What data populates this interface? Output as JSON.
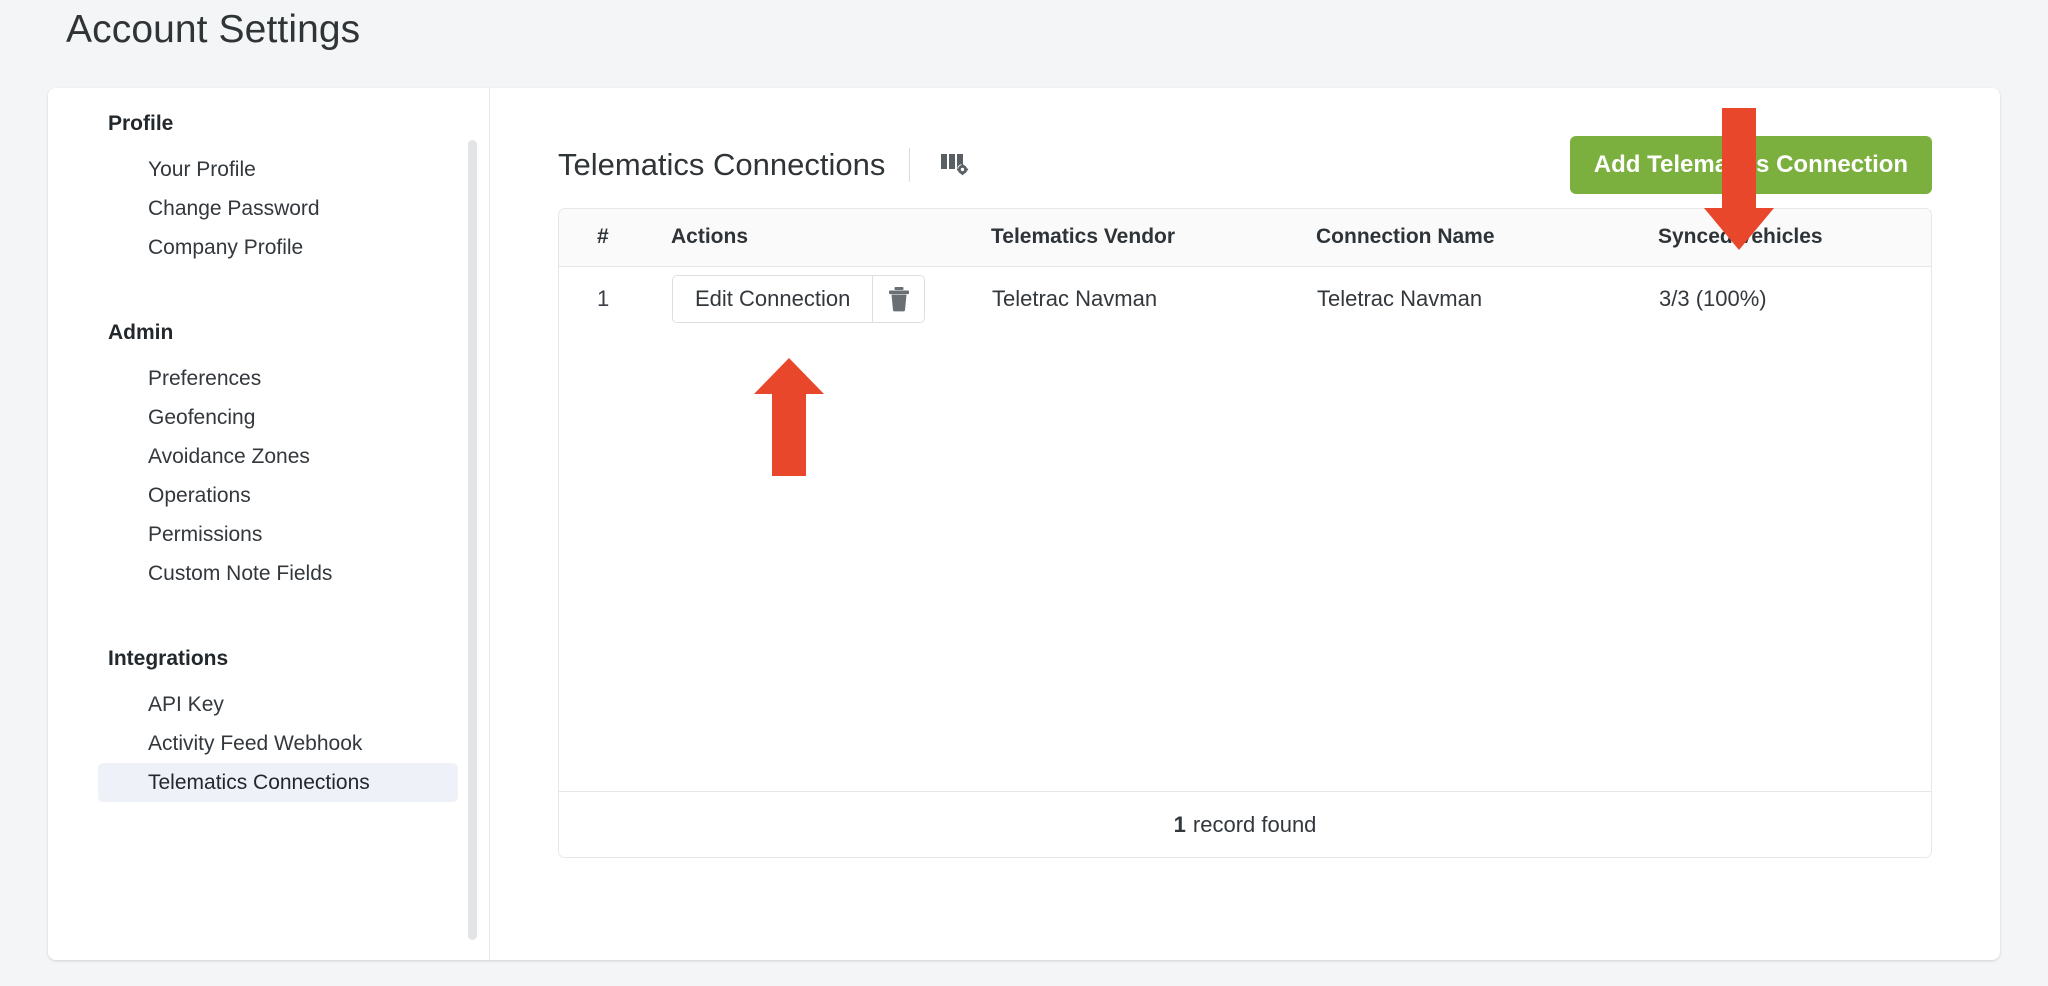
{
  "page": {
    "title": "Account Settings"
  },
  "sidebar": {
    "groups": [
      {
        "title": "Profile",
        "items": [
          {
            "label": "Your Profile",
            "active": false
          },
          {
            "label": "Change Password",
            "active": false
          },
          {
            "label": "Company Profile",
            "active": false
          }
        ]
      },
      {
        "title": "Admin",
        "items": [
          {
            "label": "Preferences",
            "active": false
          },
          {
            "label": "Geofencing",
            "active": false
          },
          {
            "label": "Avoidance Zones",
            "active": false
          },
          {
            "label": "Operations",
            "active": false
          },
          {
            "label": "Permissions",
            "active": false
          },
          {
            "label": "Custom Note Fields",
            "active": false
          }
        ]
      },
      {
        "title": "Integrations",
        "items": [
          {
            "label": "API Key",
            "active": false
          },
          {
            "label": "Activity Feed Webhook",
            "active": false
          },
          {
            "label": "Telematics Connections",
            "active": true
          }
        ]
      }
    ]
  },
  "content": {
    "panel_title": "Telematics Connections",
    "columns_settings_icon": "columns-settings-icon",
    "add_button_label": "Add Telematics Connection",
    "table": {
      "headers": [
        "#",
        "Actions",
        "Telematics Vendor",
        "Connection Name",
        "Synced Vehicles"
      ],
      "rows": [
        {
          "num": "1",
          "edit_label": "Edit Connection",
          "delete_icon": "trash-icon",
          "vendor": "Teletrac Navman",
          "connection_name": "Teletrac Navman",
          "synced_vehicles": "3/3 (100%)"
        }
      ]
    },
    "footer": {
      "count": "1",
      "label": "record found"
    }
  },
  "annotations": [
    {
      "name": "arrow-up-edit-connection",
      "direction": "up"
    },
    {
      "name": "arrow-down-add-connection",
      "direction": "down"
    }
  ],
  "colors": {
    "accent_green": "#7bb03f",
    "annotation_red": "#e8472c",
    "active_nav_bg": "#eef2f8",
    "page_bg": "#f4f5f7"
  }
}
